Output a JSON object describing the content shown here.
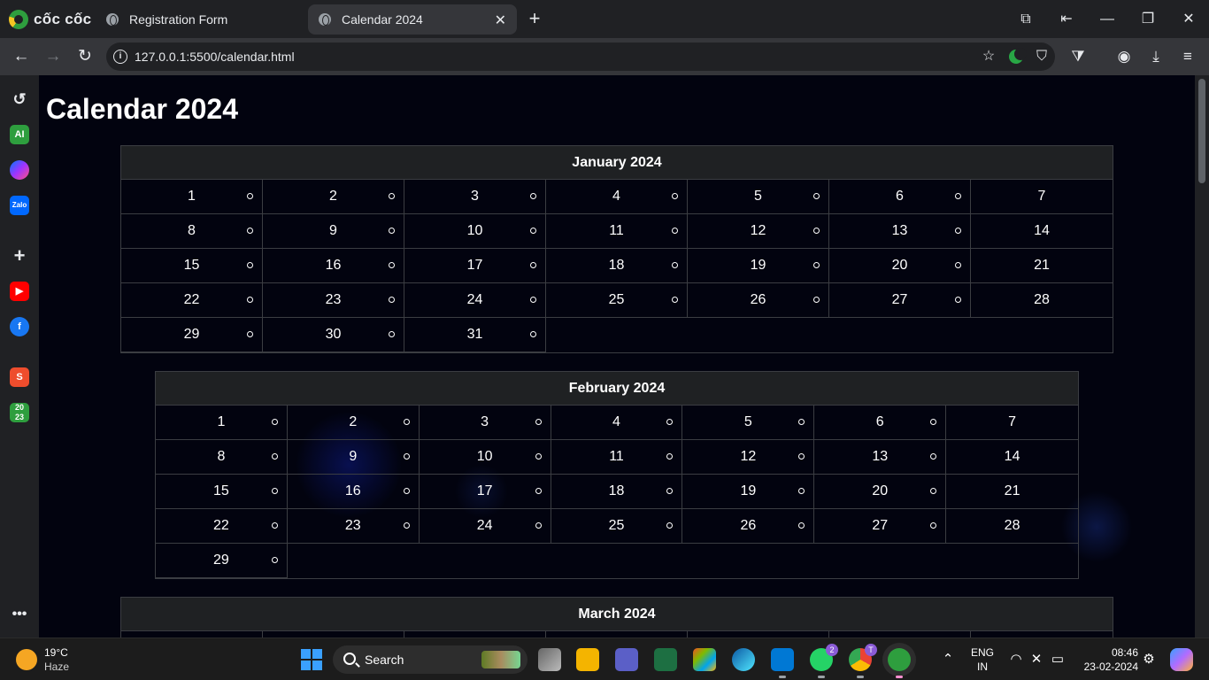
{
  "browser": {
    "brand": "cốc cốc",
    "tabs": [
      {
        "title": "Registration Form",
        "active": false
      },
      {
        "title": "Calendar 2024",
        "active": true
      }
    ],
    "url": "127.0.0.1:5500/calendar.html"
  },
  "page": {
    "title": "Calendar 2024",
    "months": [
      {
        "name": "January 2024",
        "days": 31
      },
      {
        "name": "February 2024",
        "days": 29
      },
      {
        "name": "March 2024",
        "days": 0
      }
    ]
  },
  "taskbar": {
    "weather_temp": "19°C",
    "weather_desc": "Haze",
    "search_label": "Search",
    "whatsapp_badge": "2",
    "chrome_badge": "T",
    "lang_top": "ENG",
    "lang_bottom": "IN",
    "time": "08:46",
    "date": "23-02-2024"
  },
  "colors": {
    "accent": "#28a745",
    "page_bg": "#02030f",
    "header_bg": "#1f2123"
  }
}
